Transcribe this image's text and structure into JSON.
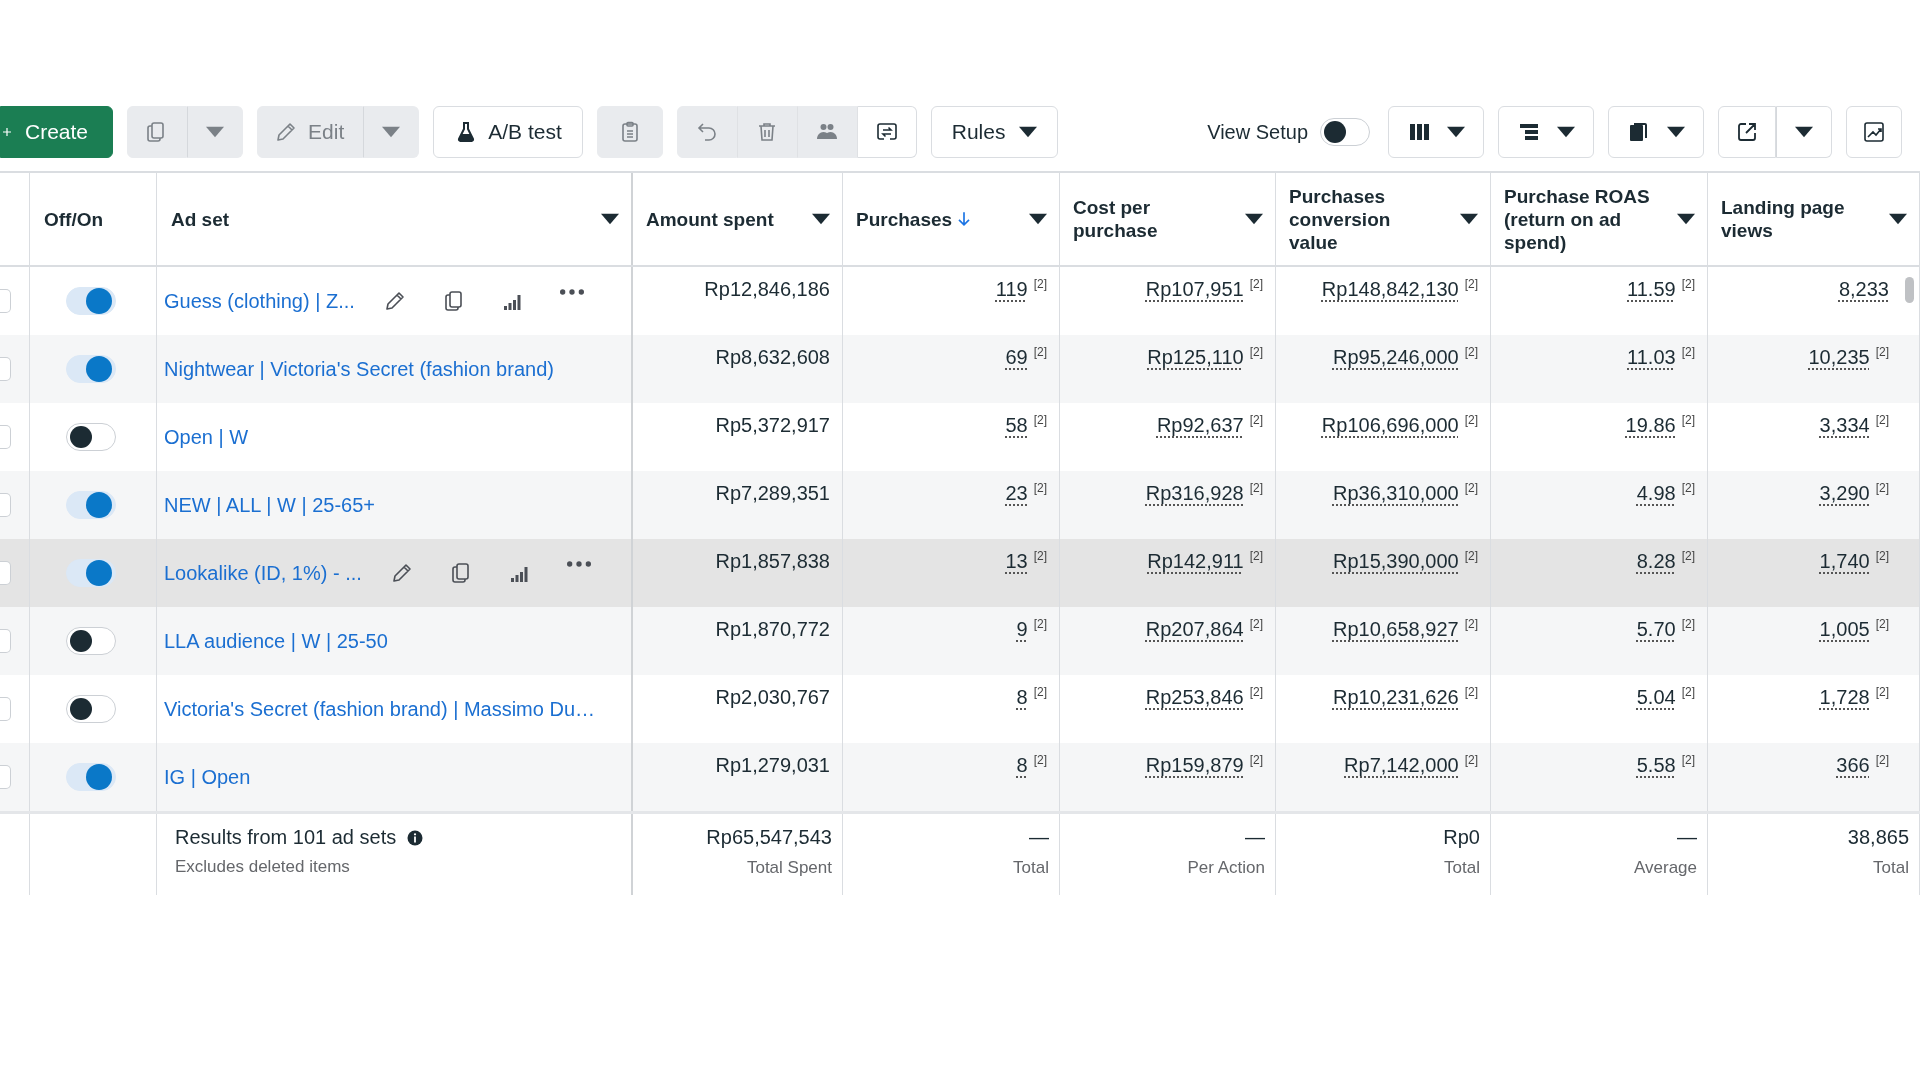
{
  "toolbar": [
    {
      "kind": "create",
      "label": "Create"
    },
    {
      "kind": "split",
      "disabled": true
    },
    {
      "kind": "split",
      "label": "Edit",
      "disabled": true
    },
    {
      "kind": "button",
      "label": "A/B test",
      "disabled": false
    },
    {
      "kind": "button",
      "disabled": true
    },
    {
      "kind": "group",
      "items": [
        {
          "disabled": true
        },
        {
          "disabled": true
        },
        {
          "disabled": true
        },
        {
          "disabled": false
        }
      ]
    },
    {
      "kind": "dropdown",
      "label": "Rules",
      "disabled": false
    }
  ],
  "view_setup": {
    "label": "View Setup",
    "on": false
  },
  "tools": [
    {
      "kind": "dropdown"
    },
    {
      "kind": "dropdown"
    },
    {
      "kind": "dropdown"
    },
    {
      "kind": "split"
    },
    {
      "kind": "button"
    }
  ],
  "table": {
    "columns": [
      {
        "label": "Off/On",
        "menu": false,
        "sorted": false
      },
      {
        "label": "Ad set",
        "menu": true,
        "sorted": false
      },
      {
        "label": "Amount spent",
        "menu": true,
        "sorted": false
      },
      {
        "label": "Purchases",
        "menu": true,
        "sorted": true
      },
      {
        "label": "Cost per purchase",
        "menu": true,
        "sorted": false
      },
      {
        "label": "Purchases conversion value",
        "menu": true,
        "sorted": false
      },
      {
        "label": "Purchase ROAS (return on ad spend)",
        "menu": true,
        "sorted": false
      },
      {
        "label": "Landing page views",
        "menu": true,
        "sorted": false
      }
    ],
    "rows": [
      {
        "checked": false,
        "actions": true,
        "highlighted": false,
        "cells": [
          {
            "kind": "toggle",
            "on": true
          },
          {
            "kind": "link",
            "value": "Guess (clothing) | Z..."
          },
          {
            "kind": "amount",
            "value": "Rp12,846,186"
          },
          {
            "kind": "metric",
            "value": "119",
            "note": "[2]"
          },
          {
            "kind": "metric",
            "value": "Rp107,951",
            "note": "[2]"
          },
          {
            "kind": "metric",
            "value": "Rp148,842,130",
            "note": "[2]"
          },
          {
            "kind": "metric",
            "value": "11.59",
            "note": "[2]"
          },
          {
            "kind": "metric",
            "value": "8,233"
          }
        ]
      },
      {
        "checked": false,
        "actions": false,
        "highlighted": false,
        "cells": [
          {
            "kind": "toggle",
            "on": true
          },
          {
            "kind": "link",
            "value": "Nightwear | Victoria's Secret (fashion brand)"
          },
          {
            "kind": "amount",
            "value": "Rp8,632,608"
          },
          {
            "kind": "metric",
            "value": "69",
            "note": "[2]"
          },
          {
            "kind": "metric",
            "value": "Rp125,110",
            "note": "[2]"
          },
          {
            "kind": "metric",
            "value": "Rp95,246,000",
            "note": "[2]"
          },
          {
            "kind": "metric",
            "value": "11.03",
            "note": "[2]"
          },
          {
            "kind": "metric",
            "value": "10,235",
            "note": "[2]"
          }
        ]
      },
      {
        "checked": false,
        "actions": false,
        "highlighted": false,
        "cells": [
          {
            "kind": "toggle",
            "on": false
          },
          {
            "kind": "link",
            "value": "Open | W"
          },
          {
            "kind": "amount",
            "value": "Rp5,372,917"
          },
          {
            "kind": "metric",
            "value": "58",
            "note": "[2]"
          },
          {
            "kind": "metric",
            "value": "Rp92,637",
            "note": "[2]"
          },
          {
            "kind": "metric",
            "value": "Rp106,696,000",
            "note": "[2]"
          },
          {
            "kind": "metric",
            "value": "19.86",
            "note": "[2]"
          },
          {
            "kind": "metric",
            "value": "3,334",
            "note": "[2]"
          }
        ]
      },
      {
        "checked": false,
        "actions": false,
        "highlighted": false,
        "cells": [
          {
            "kind": "toggle",
            "on": true
          },
          {
            "kind": "link",
            "value": "NEW | ALL | W | 25-65+"
          },
          {
            "kind": "amount",
            "value": "Rp7,289,351"
          },
          {
            "kind": "metric",
            "value": "23",
            "note": "[2]"
          },
          {
            "kind": "metric",
            "value": "Rp316,928",
            "note": "[2]"
          },
          {
            "kind": "metric",
            "value": "Rp36,310,000",
            "note": "[2]"
          },
          {
            "kind": "metric",
            "value": "4.98",
            "note": "[2]"
          },
          {
            "kind": "metric",
            "value": "3,290",
            "note": "[2]"
          }
        ]
      },
      {
        "checked": false,
        "actions": true,
        "highlighted": true,
        "cells": [
          {
            "kind": "toggle",
            "on": true
          },
          {
            "kind": "link",
            "value": "Lookalike (ID, 1%) - ..."
          },
          {
            "kind": "amount",
            "value": "Rp1,857,838"
          },
          {
            "kind": "metric",
            "value": "13",
            "note": "[2]"
          },
          {
            "kind": "metric",
            "value": "Rp142,911",
            "note": "[2]"
          },
          {
            "kind": "metric",
            "value": "Rp15,390,000",
            "note": "[2]"
          },
          {
            "kind": "metric",
            "value": "8.28",
            "note": "[2]"
          },
          {
            "kind": "metric",
            "value": "1,740",
            "note": "[2]"
          }
        ]
      },
      {
        "checked": false,
        "actions": false,
        "highlighted": false,
        "cells": [
          {
            "kind": "toggle",
            "on": false
          },
          {
            "kind": "link",
            "value": "LLA audience | W | 25-50"
          },
          {
            "kind": "amount",
            "value": "Rp1,870,772"
          },
          {
            "kind": "metric",
            "value": "9",
            "note": "[2]"
          },
          {
            "kind": "metric",
            "value": "Rp207,864",
            "note": "[2]"
          },
          {
            "kind": "metric",
            "value": "Rp10,658,927",
            "note": "[2]"
          },
          {
            "kind": "metric",
            "value": "5.70",
            "note": "[2]"
          },
          {
            "kind": "metric",
            "value": "1,005",
            "note": "[2]"
          }
        ]
      },
      {
        "checked": false,
        "actions": false,
        "highlighted": false,
        "cells": [
          {
            "kind": "toggle",
            "on": false
          },
          {
            "kind": "link",
            "value": "Victoria's Secret (fashion brand) | Massimo Du…"
          },
          {
            "kind": "amount",
            "value": "Rp2,030,767"
          },
          {
            "kind": "metric",
            "value": "8",
            "note": "[2]"
          },
          {
            "kind": "metric",
            "value": "Rp253,846",
            "note": "[2]"
          },
          {
            "kind": "metric",
            "value": "Rp10,231,626",
            "note": "[2]"
          },
          {
            "kind": "metric",
            "value": "5.04",
            "note": "[2]"
          },
          {
            "kind": "metric",
            "value": "1,728",
            "note": "[2]"
          }
        ]
      },
      {
        "checked": false,
        "actions": false,
        "highlighted": false,
        "cells": [
          {
            "kind": "toggle",
            "on": true
          },
          {
            "kind": "link",
            "value": "IG | Open"
          },
          {
            "kind": "amount",
            "value": "Rp1,279,031"
          },
          {
            "kind": "metric",
            "value": "8",
            "note": "[2]"
          },
          {
            "kind": "metric",
            "value": "Rp159,879",
            "note": "[2]"
          },
          {
            "kind": "metric",
            "value": "Rp7,142,000",
            "note": "[2]"
          },
          {
            "kind": "metric",
            "value": "5.58",
            "note": "[2]"
          },
          {
            "kind": "metric",
            "value": "366",
            "note": "[2]"
          }
        ]
      }
    ],
    "footer": {
      "title": "Results from 101 ad sets",
      "subtitle": "Excludes deleted items",
      "cells": [
        {
          "value": "Rp65,547,543",
          "label": "Total Spent"
        },
        {
          "value": "—",
          "label": "Total"
        },
        {
          "value": "—",
          "label": "Per Action"
        },
        {
          "value": "Rp0",
          "label": "Total"
        },
        {
          "value": "—",
          "label": "Average"
        },
        {
          "value": "38,865",
          "label": "Total"
        }
      ]
    }
  }
}
